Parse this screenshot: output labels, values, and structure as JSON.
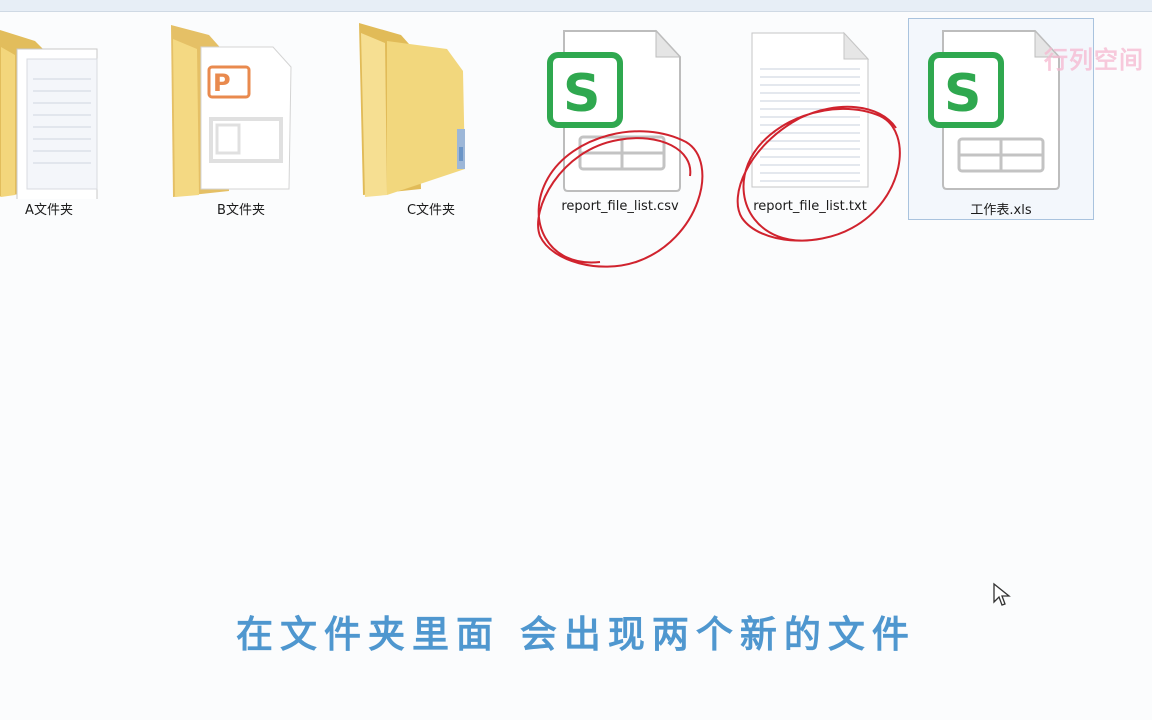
{
  "files": [
    {
      "name": "A文件夹",
      "type": "folder-docs",
      "selected": false
    },
    {
      "name": "B文件夹",
      "type": "folder-ppt",
      "selected": false
    },
    {
      "name": "C文件夹",
      "type": "folder",
      "selected": false
    },
    {
      "name": "report_file_list.csv",
      "type": "csv",
      "selected": false,
      "circled": true
    },
    {
      "name": "report_file_list.txt",
      "type": "txt",
      "selected": false,
      "circled": true
    },
    {
      "name": "工作表.xls",
      "type": "xls",
      "selected": true
    }
  ],
  "watermark": "行列空间",
  "subtitle": "在文件夹里面  会出现两个新的文件",
  "colors": {
    "accent": "#4f97cf",
    "annotation": "#d0232e",
    "wps_green": "#2fa84f",
    "folder": "#f2d77d"
  }
}
